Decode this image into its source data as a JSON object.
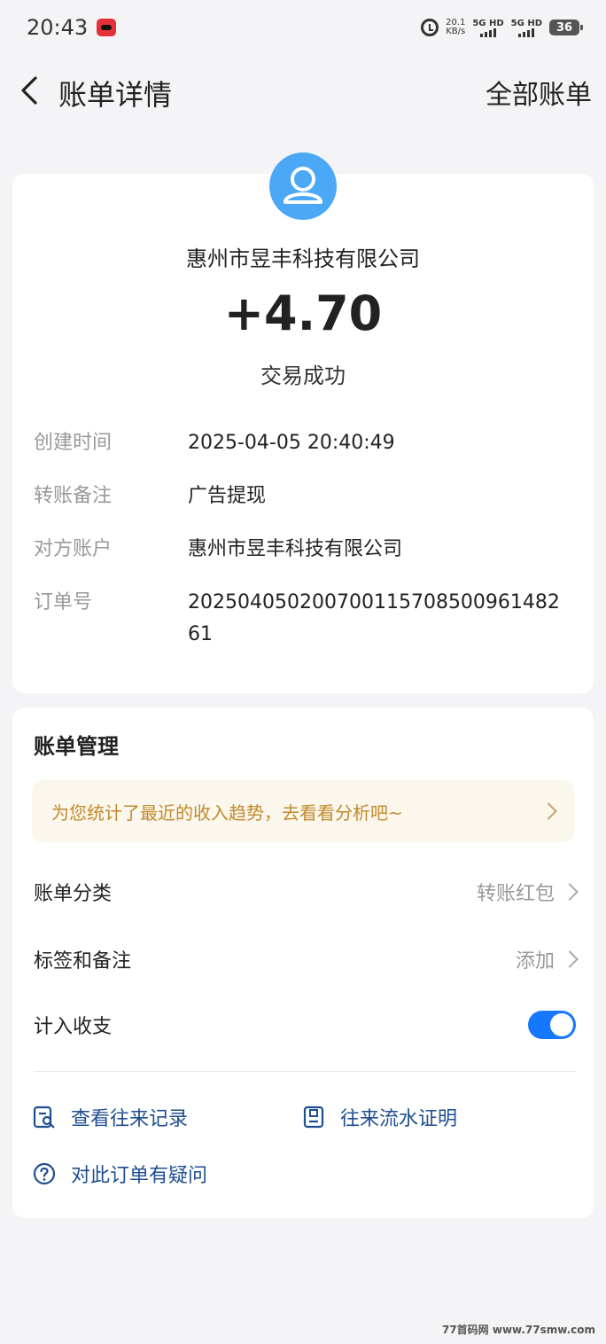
{
  "status_bar": {
    "time": "20:43",
    "net_speed": "20.1",
    "net_unit": "KB/s",
    "sim1": "5G HD",
    "sim2": "5G HD",
    "battery": "36"
  },
  "nav": {
    "title": "账单详情",
    "right_link": "全部账单"
  },
  "summary": {
    "merchant": "惠州市昱丰科技有限公司",
    "amount": "+4.70",
    "status": "交易成功"
  },
  "details": [
    {
      "label": "创建时间",
      "value": "2025-04-05 20:40:49"
    },
    {
      "label": "转账备注",
      "value": "广告提现"
    },
    {
      "label": "对方账户",
      "value": "惠州市昱丰科技有限公司"
    },
    {
      "label": "订单号",
      "value": "202504050200700115708500961482 61"
    }
  ],
  "manage": {
    "title": "账单管理",
    "tip": "为您统计了最近的收入趋势，去看看分析吧~",
    "category_label": "账单分类",
    "category_value": "转账红包",
    "tags_label": "标签和备注",
    "tags_value": "添加",
    "count_label": "计入收支",
    "count_enabled": true,
    "link_records": "查看往来记录",
    "link_proof": "往来流水证明",
    "link_question": "对此订单有疑问"
  },
  "colors": {
    "accent": "#1677ff",
    "link": "#1f4e91",
    "tip_bg": "#fbf7ec",
    "tip_text": "#c18a2e",
    "avatar": "#4aa8f7"
  },
  "icons": {
    "back": "chevron-left-icon",
    "avatar": "user-icon",
    "records": "document-search-icon",
    "proof": "certificate-icon",
    "question": "question-circle-icon"
  },
  "watermark": "77首码网 www.77smw.com"
}
